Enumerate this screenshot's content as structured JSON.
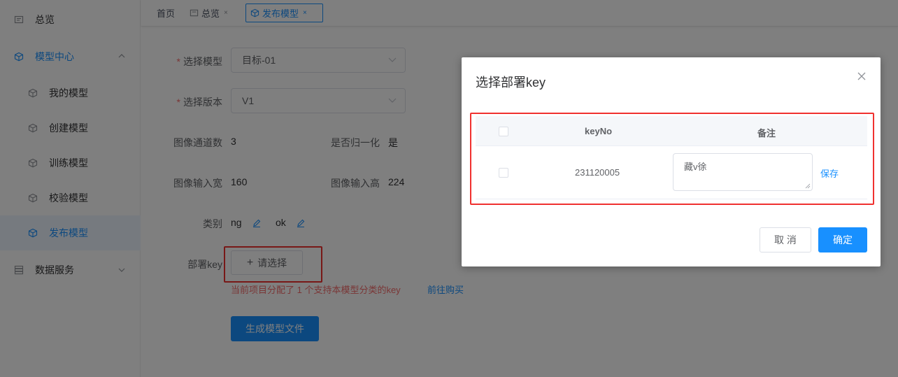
{
  "sidebar": {
    "items": [
      {
        "label": "总览",
        "icon": "dashboard-icon"
      },
      {
        "label": "模型中心",
        "icon": "cube-icon"
      },
      {
        "label": "我的模型",
        "icon": "cube-icon"
      },
      {
        "label": "创建模型",
        "icon": "cube-icon"
      },
      {
        "label": "训练模型",
        "icon": "cube-icon"
      },
      {
        "label": "校验模型",
        "icon": "cube-icon"
      },
      {
        "label": "发布模型",
        "icon": "cube-icon"
      },
      {
        "label": "数据服务",
        "icon": "database-icon"
      }
    ]
  },
  "tabs": {
    "home": "首页",
    "overview": "总览",
    "publish": "发布模型",
    "close_glyph": "×"
  },
  "form": {
    "model_label": "选择模型",
    "model_value": "目标-01",
    "version_label": "选择版本",
    "version_value": "V1",
    "channels_label": "图像通道数",
    "channels_value": "3",
    "normalize_label": "是否归一化",
    "normalize_value": "是",
    "width_label": "图像输入宽",
    "width_value": "160",
    "height_label": "图像输入高",
    "height_value": "224",
    "category_label": "类别",
    "categories": [
      "ng",
      "ok"
    ],
    "key_label": "部署key",
    "choose_button": "请选择",
    "hint_text": "当前项目分配了 1 个支持本模型分类的key",
    "buy_link": "前往购买",
    "generate_button": "生成模型文件"
  },
  "dialog": {
    "title": "选择部署key",
    "columns": [
      "keyNo",
      "备注"
    ],
    "rows": [
      {
        "key_no": "231120005",
        "remark": "藏v徐",
        "save": "保存"
      }
    ],
    "cancel_button": "取 消",
    "ok_button": "确定"
  },
  "colors": {
    "primary": "#1890ff",
    "danger": "#f56c6c",
    "highlight_frame": "#f0312f"
  }
}
